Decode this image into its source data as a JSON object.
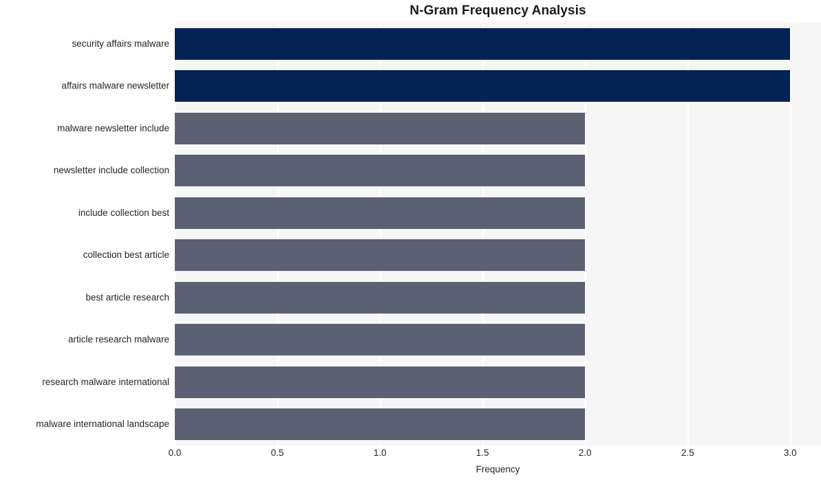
{
  "chart_data": {
    "type": "bar",
    "orientation": "horizontal",
    "title": "N-Gram Frequency Analysis",
    "xlabel": "Frequency",
    "ylabel": "",
    "xlim": [
      0.0,
      3.15
    ],
    "xticks": [
      "0.0",
      "0.5",
      "1.0",
      "1.5",
      "2.0",
      "2.5",
      "3.0"
    ],
    "xtick_values": [
      0.0,
      0.5,
      1.0,
      1.5,
      2.0,
      2.5,
      3.0
    ],
    "grid": true,
    "grid_axis": "x",
    "legend": "none",
    "categories": [
      "security affairs malware",
      "affairs malware newsletter",
      "malware newsletter include",
      "newsletter include collection",
      "include collection best",
      "collection best article",
      "best article research",
      "article research malware",
      "research malware international",
      "malware international landscape"
    ],
    "values": [
      3,
      3,
      2,
      2,
      2,
      2,
      2,
      2,
      2,
      2
    ],
    "bar_colors": [
      "#042253",
      "#042253",
      "#5b6073",
      "#5b6073",
      "#5b6073",
      "#5b6073",
      "#5b6073",
      "#5b6073",
      "#5b6073",
      "#5b6073"
    ]
  },
  "style": {
    "figure_background": "#ffffff",
    "plot_background": "#f6f6f7",
    "gridline_color": "#ffffff",
    "text_color": "#262626",
    "title_color": "#1a1a1a",
    "highlight_color": "#042253",
    "base_color": "#5b6073"
  }
}
